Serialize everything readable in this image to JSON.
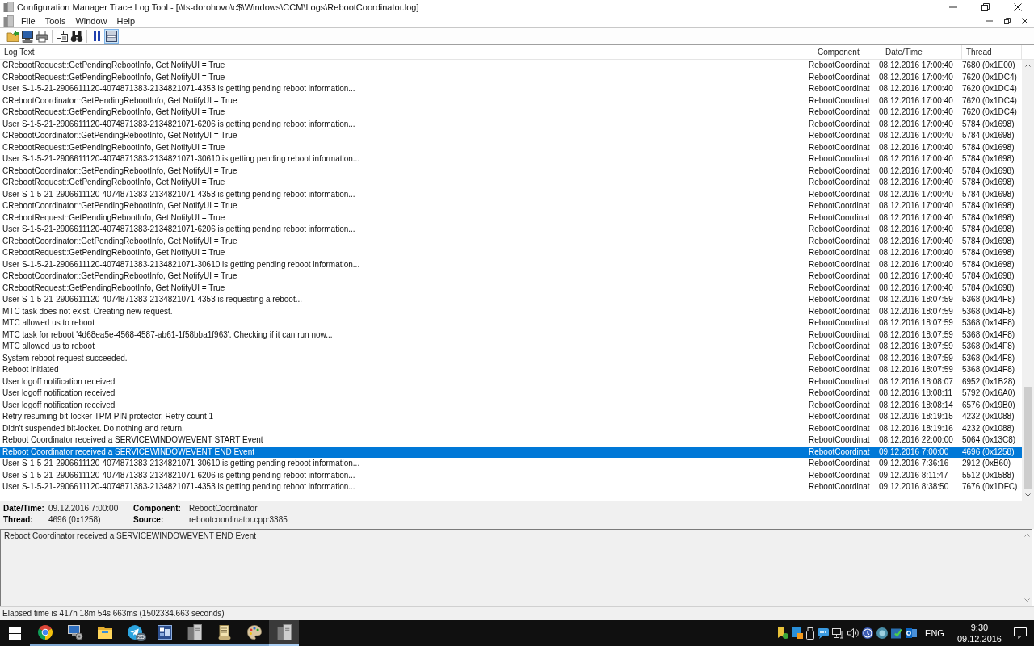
{
  "window": {
    "title": "Configuration Manager Trace Log Tool - [\\\\ts-dorohovo\\c$\\Windows\\CCM\\Logs\\RebootCoordinator.log]"
  },
  "menu": [
    "File",
    "Tools",
    "Window",
    "Help"
  ],
  "toolbar": [
    [
      {
        "kind": "open",
        "pressed": false
      },
      {
        "kind": "computer",
        "pressed": false
      },
      {
        "kind": "print",
        "pressed": false
      }
    ],
    [
      {
        "kind": "copy",
        "pressed": false
      },
      {
        "kind": "find",
        "pressed": false
      }
    ],
    [
      {
        "kind": "pause",
        "pressed": false
      },
      {
        "kind": "highlight",
        "pressed": true
      }
    ]
  ],
  "log_list": {
    "columns": [
      "Log Text",
      "Component",
      "Date/Time",
      "Thread"
    ],
    "rows": [
      {
        "text": "CRebootRequest::GetPendingRebootInfo, Get NotifyUI = True",
        "component": "RebootCoordinat",
        "date_time": "08.12.2016 17:00:40",
        "thread": "7680 (0x1E00)",
        "selected": false
      },
      {
        "text": "CRebootRequest::GetPendingRebootInfo, Get NotifyUI = True",
        "component": "RebootCoordinat",
        "date_time": "08.12.2016 17:00:40",
        "thread": "7620 (0x1DC4)",
        "selected": false
      },
      {
        "text": "User S-1-5-21-2906611120-4074871383-2134821071-4353 is getting pending reboot information...",
        "component": "RebootCoordinat",
        "date_time": "08.12.2016 17:00:40",
        "thread": "7620 (0x1DC4)",
        "selected": false
      },
      {
        "text": "CRebootCoordinator::GetPendingRebootInfo, Get NotifyUI = True",
        "component": "RebootCoordinat",
        "date_time": "08.12.2016 17:00:40",
        "thread": "7620 (0x1DC4)",
        "selected": false
      },
      {
        "text": "CRebootRequest::GetPendingRebootInfo, Get NotifyUI = True",
        "component": "RebootCoordinat",
        "date_time": "08.12.2016 17:00:40",
        "thread": "7620 (0x1DC4)",
        "selected": false
      },
      {
        "text": "User S-1-5-21-2906611120-4074871383-2134821071-6206 is getting pending reboot information...",
        "component": "RebootCoordinat",
        "date_time": "08.12.2016 17:00:40",
        "thread": "5784 (0x1698)",
        "selected": false
      },
      {
        "text": "CRebootCoordinator::GetPendingRebootInfo, Get NotifyUI = True",
        "component": "RebootCoordinat",
        "date_time": "08.12.2016 17:00:40",
        "thread": "5784 (0x1698)",
        "selected": false
      },
      {
        "text": "CRebootRequest::GetPendingRebootInfo, Get NotifyUI = True",
        "component": "RebootCoordinat",
        "date_time": "08.12.2016 17:00:40",
        "thread": "5784 (0x1698)",
        "selected": false
      },
      {
        "text": "User S-1-5-21-2906611120-4074871383-2134821071-30610 is getting pending reboot information...",
        "component": "RebootCoordinat",
        "date_time": "08.12.2016 17:00:40",
        "thread": "5784 (0x1698)",
        "selected": false
      },
      {
        "text": "CRebootCoordinator::GetPendingRebootInfo, Get NotifyUI = True",
        "component": "RebootCoordinat",
        "date_time": "08.12.2016 17:00:40",
        "thread": "5784 (0x1698)",
        "selected": false
      },
      {
        "text": "CRebootRequest::GetPendingRebootInfo, Get NotifyUI = True",
        "component": "RebootCoordinat",
        "date_time": "08.12.2016 17:00:40",
        "thread": "5784 (0x1698)",
        "selected": false
      },
      {
        "text": "User S-1-5-21-2906611120-4074871383-2134821071-4353 is getting pending reboot information...",
        "component": "RebootCoordinat",
        "date_time": "08.12.2016 17:00:40",
        "thread": "5784 (0x1698)",
        "selected": false
      },
      {
        "text": "CRebootCoordinator::GetPendingRebootInfo, Get NotifyUI = True",
        "component": "RebootCoordinat",
        "date_time": "08.12.2016 17:00:40",
        "thread": "5784 (0x1698)",
        "selected": false
      },
      {
        "text": "CRebootRequest::GetPendingRebootInfo, Get NotifyUI = True",
        "component": "RebootCoordinat",
        "date_time": "08.12.2016 17:00:40",
        "thread": "5784 (0x1698)",
        "selected": false
      },
      {
        "text": "User S-1-5-21-2906611120-4074871383-2134821071-6206 is getting pending reboot information...",
        "component": "RebootCoordinat",
        "date_time": "08.12.2016 17:00:40",
        "thread": "5784 (0x1698)",
        "selected": false
      },
      {
        "text": "CRebootCoordinator::GetPendingRebootInfo, Get NotifyUI = True",
        "component": "RebootCoordinat",
        "date_time": "08.12.2016 17:00:40",
        "thread": "5784 (0x1698)",
        "selected": false
      },
      {
        "text": "CRebootRequest::GetPendingRebootInfo, Get NotifyUI = True",
        "component": "RebootCoordinat",
        "date_time": "08.12.2016 17:00:40",
        "thread": "5784 (0x1698)",
        "selected": false
      },
      {
        "text": "User S-1-5-21-2906611120-4074871383-2134821071-30610 is getting pending reboot information...",
        "component": "RebootCoordinat",
        "date_time": "08.12.2016 17:00:40",
        "thread": "5784 (0x1698)",
        "selected": false
      },
      {
        "text": "CRebootCoordinator::GetPendingRebootInfo, Get NotifyUI = True",
        "component": "RebootCoordinat",
        "date_time": "08.12.2016 17:00:40",
        "thread": "5784 (0x1698)",
        "selected": false
      },
      {
        "text": "CRebootRequest::GetPendingRebootInfo, Get NotifyUI = True",
        "component": "RebootCoordinat",
        "date_time": "08.12.2016 17:00:40",
        "thread": "5784 (0x1698)",
        "selected": false
      },
      {
        "text": "User S-1-5-21-2906611120-4074871383-2134821071-4353 is requesting a reboot...",
        "component": "RebootCoordinat",
        "date_time": "08.12.2016 18:07:59",
        "thread": "5368 (0x14F8)",
        "selected": false
      },
      {
        "text": "MTC task does not exist. Creating new request.",
        "component": "RebootCoordinat",
        "date_time": "08.12.2016 18:07:59",
        "thread": "5368 (0x14F8)",
        "selected": false
      },
      {
        "text": "MTC allowed us to reboot",
        "component": "RebootCoordinat",
        "date_time": "08.12.2016 18:07:59",
        "thread": "5368 (0x14F8)",
        "selected": false
      },
      {
        "text": "MTC task for reboot '4d68ea5e-4568-4587-ab61-1f58bba1f963'. Checking if it can run now...",
        "component": "RebootCoordinat",
        "date_time": "08.12.2016 18:07:59",
        "thread": "5368 (0x14F8)",
        "selected": false
      },
      {
        "text": "MTC allowed us to reboot",
        "component": "RebootCoordinat",
        "date_time": "08.12.2016 18:07:59",
        "thread": "5368 (0x14F8)",
        "selected": false
      },
      {
        "text": "System reboot request succeeded.",
        "component": "RebootCoordinat",
        "date_time": "08.12.2016 18:07:59",
        "thread": "5368 (0x14F8)",
        "selected": false
      },
      {
        "text": "Reboot initiated",
        "component": "RebootCoordinat",
        "date_time": "08.12.2016 18:07:59",
        "thread": "5368 (0x14F8)",
        "selected": false
      },
      {
        "text": "User logoff notification received",
        "component": "RebootCoordinat",
        "date_time": "08.12.2016 18:08:07",
        "thread": "6952 (0x1B28)",
        "selected": false
      },
      {
        "text": "User logoff notification received",
        "component": "RebootCoordinat",
        "date_time": "08.12.2016 18:08:11",
        "thread": "5792 (0x16A0)",
        "selected": false
      },
      {
        "text": "User logoff notification received",
        "component": "RebootCoordinat",
        "date_time": "08.12.2016 18:08:14",
        "thread": "6576 (0x19B0)",
        "selected": false
      },
      {
        "text": "Retry resuming bit-locker TPM PIN protector. Retry count 1",
        "component": "RebootCoordinat",
        "date_time": "08.12.2016 18:19:15",
        "thread": "4232 (0x1088)",
        "selected": false
      },
      {
        "text": "Didn't suspended bit-locker. Do nothing and return.",
        "component": "RebootCoordinat",
        "date_time": "08.12.2016 18:19:16",
        "thread": "4232 (0x1088)",
        "selected": false
      },
      {
        "text": "Reboot Coordinator received a SERVICEWINDOWEVENT START Event",
        "component": "RebootCoordinat",
        "date_time": "08.12.2016 22:00:00",
        "thread": "5064 (0x13C8)",
        "selected": false
      },
      {
        "text": "Reboot Coordinator received a SERVICEWINDOWEVENT END Event",
        "component": "RebootCoordinat",
        "date_time": "09.12.2016 7:00:00",
        "thread": "4696 (0x1258)",
        "selected": true
      },
      {
        "text": "User S-1-5-21-2906611120-4074871383-2134821071-30610 is getting pending reboot information...",
        "component": "RebootCoordinat",
        "date_time": "09.12.2016 7:36:16",
        "thread": "2912 (0xB60)",
        "selected": false
      },
      {
        "text": "User S-1-5-21-2906611120-4074871383-2134821071-6206 is getting pending reboot information...",
        "component": "RebootCoordinat",
        "date_time": "09.12.2016 8:11:47",
        "thread": "5512 (0x1588)",
        "selected": false
      },
      {
        "text": "User S-1-5-21-2906611120-4074871383-2134821071-4353 is getting pending reboot information...",
        "component": "RebootCoordinat",
        "date_time": "09.12.2016 8:38:50",
        "thread": "7676 (0x1DFC)",
        "selected": false
      }
    ]
  },
  "details": {
    "fields": [
      {
        "label": "Date/Time:",
        "value": "09.12.2016 7:00:00"
      },
      {
        "label": "Component:",
        "value": "RebootCoordinator"
      },
      {
        "label": "Thread:",
        "value": "4696 (0x1258)"
      },
      {
        "label": "Source:",
        "value": "rebootcoordinator.cpp:3385"
      }
    ],
    "message": "Reboot Coordinator received a SERVICEWINDOWEVENT END Event"
  },
  "status_bar": "Elapsed time is 417h 18m 54s 663ms (1502334.663 seconds)",
  "taskbar": {
    "apps": [
      {
        "kind": "browser",
        "selected": false
      },
      {
        "kind": "computer",
        "selected": false
      },
      {
        "kind": "folder",
        "selected": false
      },
      {
        "kind": "messenger",
        "badge": "25",
        "selected": false
      },
      {
        "kind": "panel",
        "selected": false
      },
      {
        "kind": "server",
        "selected": false
      },
      {
        "kind": "scroll",
        "selected": false
      },
      {
        "kind": "palette",
        "selected": false
      },
      {
        "kind": "server",
        "selected": true
      }
    ],
    "language": "ENG",
    "time": "9:30",
    "date": "09.12.2016"
  }
}
